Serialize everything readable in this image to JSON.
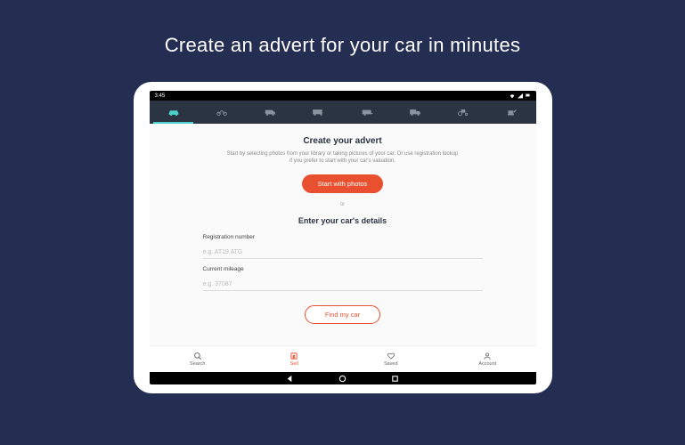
{
  "marketing": {
    "title": "Create an advert for your car in minutes"
  },
  "status": {
    "time": "3:45"
  },
  "content": {
    "title": "Create your advert",
    "description": "Start by selecting photos from your library or taking pictures of your car. Or use registration lookup if you prefer to start with your car's valuation.",
    "primary_cta": "Start with photos",
    "divider": "or",
    "subtitle": "Enter your car's details"
  },
  "fields": {
    "reg": {
      "label": "Registration number",
      "placeholder": "e.g. AT19 ATG"
    },
    "mileage": {
      "label": "Current mileage",
      "placeholder": "e.g. 37087"
    }
  },
  "find_cta": "Find my car",
  "nav": {
    "items": [
      {
        "label": "Search"
      },
      {
        "label": "Sell"
      },
      {
        "label": "Saved"
      },
      {
        "label": "Account"
      }
    ]
  }
}
